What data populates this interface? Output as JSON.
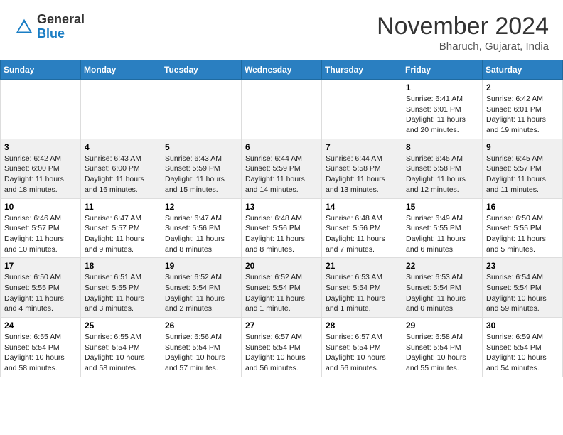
{
  "header": {
    "logo_general": "General",
    "logo_blue": "Blue",
    "month_title": "November 2024",
    "location": "Bharuch, Gujarat, India"
  },
  "weekdays": [
    "Sunday",
    "Monday",
    "Tuesday",
    "Wednesday",
    "Thursday",
    "Friday",
    "Saturday"
  ],
  "weeks": [
    [
      {
        "day": "",
        "info": ""
      },
      {
        "day": "",
        "info": ""
      },
      {
        "day": "",
        "info": ""
      },
      {
        "day": "",
        "info": ""
      },
      {
        "day": "",
        "info": ""
      },
      {
        "day": "1",
        "info": "Sunrise: 6:41 AM\nSunset: 6:01 PM\nDaylight: 11 hours\nand 20 minutes."
      },
      {
        "day": "2",
        "info": "Sunrise: 6:42 AM\nSunset: 6:01 PM\nDaylight: 11 hours\nand 19 minutes."
      }
    ],
    [
      {
        "day": "3",
        "info": "Sunrise: 6:42 AM\nSunset: 6:00 PM\nDaylight: 11 hours\nand 18 minutes."
      },
      {
        "day": "4",
        "info": "Sunrise: 6:43 AM\nSunset: 6:00 PM\nDaylight: 11 hours\nand 16 minutes."
      },
      {
        "day": "5",
        "info": "Sunrise: 6:43 AM\nSunset: 5:59 PM\nDaylight: 11 hours\nand 15 minutes."
      },
      {
        "day": "6",
        "info": "Sunrise: 6:44 AM\nSunset: 5:59 PM\nDaylight: 11 hours\nand 14 minutes."
      },
      {
        "day": "7",
        "info": "Sunrise: 6:44 AM\nSunset: 5:58 PM\nDaylight: 11 hours\nand 13 minutes."
      },
      {
        "day": "8",
        "info": "Sunrise: 6:45 AM\nSunset: 5:58 PM\nDaylight: 11 hours\nand 12 minutes."
      },
      {
        "day": "9",
        "info": "Sunrise: 6:45 AM\nSunset: 5:57 PM\nDaylight: 11 hours\nand 11 minutes."
      }
    ],
    [
      {
        "day": "10",
        "info": "Sunrise: 6:46 AM\nSunset: 5:57 PM\nDaylight: 11 hours\nand 10 minutes."
      },
      {
        "day": "11",
        "info": "Sunrise: 6:47 AM\nSunset: 5:57 PM\nDaylight: 11 hours\nand 9 minutes."
      },
      {
        "day": "12",
        "info": "Sunrise: 6:47 AM\nSunset: 5:56 PM\nDaylight: 11 hours\nand 8 minutes."
      },
      {
        "day": "13",
        "info": "Sunrise: 6:48 AM\nSunset: 5:56 PM\nDaylight: 11 hours\nand 8 minutes."
      },
      {
        "day": "14",
        "info": "Sunrise: 6:48 AM\nSunset: 5:56 PM\nDaylight: 11 hours\nand 7 minutes."
      },
      {
        "day": "15",
        "info": "Sunrise: 6:49 AM\nSunset: 5:55 PM\nDaylight: 11 hours\nand 6 minutes."
      },
      {
        "day": "16",
        "info": "Sunrise: 6:50 AM\nSunset: 5:55 PM\nDaylight: 11 hours\nand 5 minutes."
      }
    ],
    [
      {
        "day": "17",
        "info": "Sunrise: 6:50 AM\nSunset: 5:55 PM\nDaylight: 11 hours\nand 4 minutes."
      },
      {
        "day": "18",
        "info": "Sunrise: 6:51 AM\nSunset: 5:55 PM\nDaylight: 11 hours\nand 3 minutes."
      },
      {
        "day": "19",
        "info": "Sunrise: 6:52 AM\nSunset: 5:54 PM\nDaylight: 11 hours\nand 2 minutes."
      },
      {
        "day": "20",
        "info": "Sunrise: 6:52 AM\nSunset: 5:54 PM\nDaylight: 11 hours\nand 1 minute."
      },
      {
        "day": "21",
        "info": "Sunrise: 6:53 AM\nSunset: 5:54 PM\nDaylight: 11 hours\nand 1 minute."
      },
      {
        "day": "22",
        "info": "Sunrise: 6:53 AM\nSunset: 5:54 PM\nDaylight: 11 hours\nand 0 minutes."
      },
      {
        "day": "23",
        "info": "Sunrise: 6:54 AM\nSunset: 5:54 PM\nDaylight: 10 hours\nand 59 minutes."
      }
    ],
    [
      {
        "day": "24",
        "info": "Sunrise: 6:55 AM\nSunset: 5:54 PM\nDaylight: 10 hours\nand 58 minutes."
      },
      {
        "day": "25",
        "info": "Sunrise: 6:55 AM\nSunset: 5:54 PM\nDaylight: 10 hours\nand 58 minutes."
      },
      {
        "day": "26",
        "info": "Sunrise: 6:56 AM\nSunset: 5:54 PM\nDaylight: 10 hours\nand 57 minutes."
      },
      {
        "day": "27",
        "info": "Sunrise: 6:57 AM\nSunset: 5:54 PM\nDaylight: 10 hours\nand 56 minutes."
      },
      {
        "day": "28",
        "info": "Sunrise: 6:57 AM\nSunset: 5:54 PM\nDaylight: 10 hours\nand 56 minutes."
      },
      {
        "day": "29",
        "info": "Sunrise: 6:58 AM\nSunset: 5:54 PM\nDaylight: 10 hours\nand 55 minutes."
      },
      {
        "day": "30",
        "info": "Sunrise: 6:59 AM\nSunset: 5:54 PM\nDaylight: 10 hours\nand 54 minutes."
      }
    ]
  ]
}
